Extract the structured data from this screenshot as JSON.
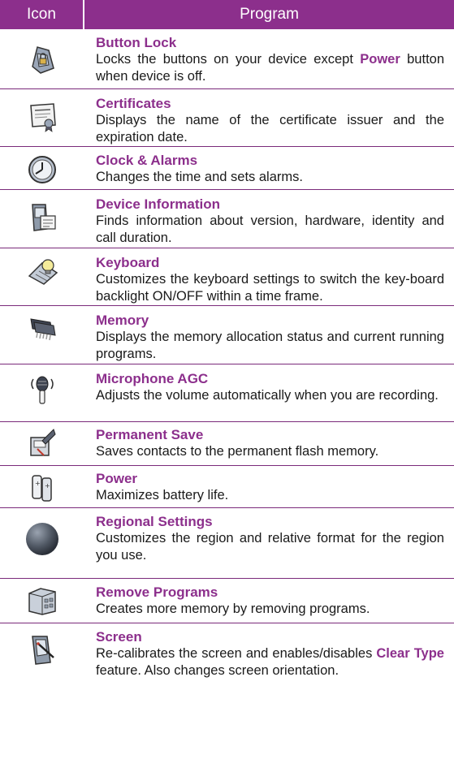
{
  "header": {
    "icon_col": "Icon",
    "program_col": "Program"
  },
  "rows": [
    {
      "icon": "button-lock-icon",
      "title": "Button Lock",
      "desc_before": "Locks the buttons on your device except ",
      "highlight": "Power",
      "desc_after": " button when device is off."
    },
    {
      "icon": "certificates-icon",
      "title": "Certificates",
      "desc": "Displays the name of the certificate issuer and the expiration date."
    },
    {
      "icon": "clock-icon",
      "title": "Clock & Alarms",
      "desc": "Changes the time and sets alarms."
    },
    {
      "icon": "device-information-icon",
      "title": "Device Information",
      "desc": "Finds information about version, hardware, identity and call duration."
    },
    {
      "icon": "keyboard-icon",
      "title": "Keyboard",
      "desc": "Customizes the keyboard settings to switch the key-board backlight ON/OFF within a time frame."
    },
    {
      "icon": "memory-chip-icon",
      "title": "Memory",
      "desc": "Displays the memory allocation status and current running programs."
    },
    {
      "icon": "microphone-icon",
      "title": "Microphone AGC",
      "desc": "Adjusts the volume automatically when you are recording."
    },
    {
      "icon": "permanent-save-icon",
      "title": "Permanent Save",
      "desc": "Saves contacts to the permanent flash memory."
    },
    {
      "icon": "battery-icon",
      "title": "Power",
      "desc": "Maximizes battery life."
    },
    {
      "icon": "globe-icon",
      "title": "Regional Settings",
      "desc": "Customizes the region and relative format for the region you use."
    },
    {
      "icon": "remove-programs-icon",
      "title": "Remove Programs",
      "desc": "Creates more memory by removing programs."
    },
    {
      "icon": "screen-icon",
      "title": "Screen",
      "desc_before": "Re-calibrates the screen and enables/disables ",
      "highlight": "Clear Type",
      "desc_after": " feature. Also changes screen orientation."
    }
  ],
  "colors": {
    "accent": "#8c2f8c",
    "text": "#1a1a1a"
  }
}
